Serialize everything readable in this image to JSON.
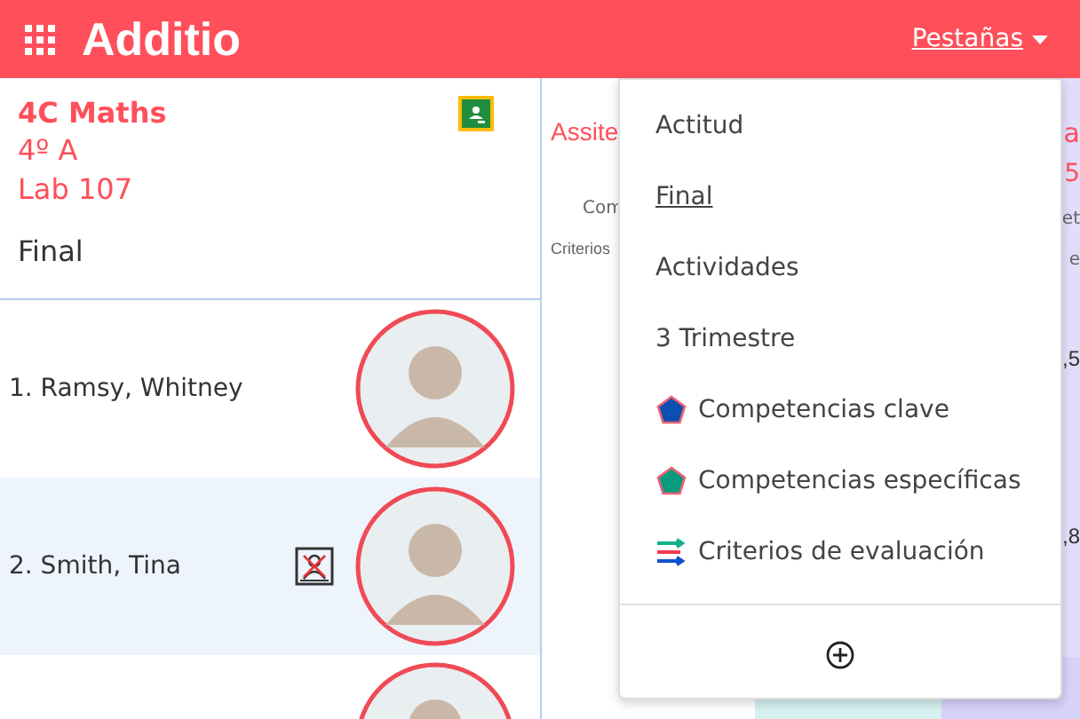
{
  "header": {
    "app_name": "Additio",
    "tabs_menu_label": "Pestañas"
  },
  "group": {
    "name": "4C Maths",
    "class": "4º A",
    "room": "Lab 107",
    "tab": "Final"
  },
  "columns": {
    "title": "Assite",
    "subtitle": "Com",
    "criteria": "Criterios",
    "right_title": "a",
    "right_sub": "5",
    "right_subtitle": "et",
    "right_criteria": "e"
  },
  "students": [
    {
      "name": "1. Ramsy, Whitney",
      "no_photo": false,
      "highlighted": false,
      "cell": ",5"
    },
    {
      "name": "2. Smith, Tina",
      "no_photo": true,
      "highlighted": true,
      "cell": ",8"
    }
  ],
  "menu": {
    "items": [
      {
        "label": "Actitud",
        "kind": "text",
        "selected": false
      },
      {
        "label": "Final",
        "kind": "text",
        "selected": true
      },
      {
        "label": "Actividades",
        "kind": "text",
        "selected": false
      },
      {
        "label": "3 Trimestre",
        "kind": "text",
        "selected": false
      },
      {
        "label": "Competencias clave",
        "kind": "pentagon",
        "color": "#0b4fb0",
        "selected": false
      },
      {
        "label": "Competencias específicas",
        "kind": "pentagon",
        "color": "#0a9a7e",
        "selected": false
      },
      {
        "label": "Criterios de evaluación",
        "kind": "arrows",
        "selected": false
      }
    ]
  }
}
